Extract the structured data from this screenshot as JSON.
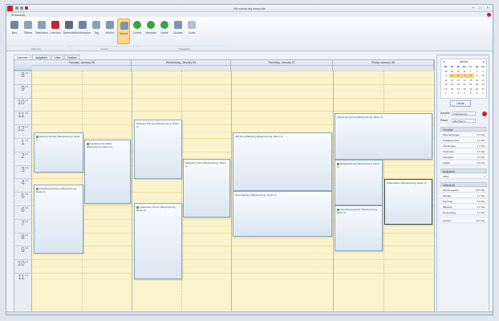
{
  "window": {
    "title": "Mit eindeutig lesscode"
  },
  "ribbon": {
    "tab": "Erfassen",
    "buttons": [
      {
        "label": "Neu",
        "color": "#6f86a0"
      },
      {
        "label": "Öffnen",
        "color": "#8aa0b6"
      },
      {
        "label": "Speichern",
        "color": "#8aa0b6"
      },
      {
        "label": "Löschen",
        "color": "#c0262d"
      },
      {
        "label": "Übersicht",
        "color": "#5a6a7a"
      },
      {
        "label": "Wochenplan",
        "color": "#6f86a0"
      },
      {
        "label": "Tag",
        "color": "#8aa0b6"
      },
      {
        "label": "Woche",
        "color": "#7f95ab"
      },
      {
        "label": "Monat",
        "color": "#7f95ab"
      },
      {
        "label": "Zurück",
        "color": "#3aa342"
      },
      {
        "label": "Vorwärts",
        "color": "#3aa342"
      },
      {
        "label": "Heute",
        "color": "#3aa342"
      },
      {
        "label": "Suchen",
        "color": "#7f95ab"
      },
      {
        "label": "Zoom",
        "color": "#b2c1d0"
      }
    ],
    "groups": [
      "Aktionen",
      "Ansicht",
      "Navigation"
    ]
  },
  "view_tabs": [
    "Kalender",
    "Aufgaben",
    "Liste",
    "Notizen"
  ],
  "days": [
    "Tuesday, January 05",
    "Wednesday, January 06",
    "Thursday, January 07",
    "Friday, January 08"
  ],
  "hours": [
    {
      "h": "8",
      "m": "00"
    },
    {
      "h": "9",
      "m": "00"
    },
    {
      "h": "10",
      "m": "00"
    },
    {
      "h": "11",
      "m": "00"
    },
    {
      "h": "12",
      "m": "00"
    },
    {
      "h": "1",
      "m": "00"
    },
    {
      "h": "2",
      "m": "00"
    },
    {
      "h": "3",
      "m": "00"
    },
    {
      "h": "4",
      "m": "00"
    },
    {
      "h": "5",
      "m": "00"
    },
    {
      "h": "6",
      "m": "00"
    },
    {
      "h": "7",
      "m": "00"
    },
    {
      "h": "8",
      "m": "00"
    },
    {
      "h": "9",
      "m": "00"
    },
    {
      "h": "10",
      "m": "00"
    },
    {
      "h": "11",
      "m": "00"
    }
  ],
  "appointments": [
    {
      "text": "Meeting Vertrieb (Besprechung, Raum 1)"
    },
    {
      "text": "Kundentermin Müller (Besprechung, Raum 2)"
    },
    {
      "text": "Projektbesprechung (Besprechung, Raum 2)"
    },
    {
      "text": "Strategie Planung (Besprechung, Raum 3)"
    },
    {
      "text": "Workshop Team (Besprechung, Raum 1)"
    },
    {
      "text": "Lieferanten Termin (Besprechung, Raum 4)"
    },
    {
      "text": "Schulung Marketing (Besprechung, Raum 1)"
    },
    {
      "text": "Team Meeting (Besprechung, Raum 2)"
    },
    {
      "text": "Abteilungsmeeting (Besprechung, Raum 2)"
    },
    {
      "text": "Budgetplanung (Besprechung, Raum 3)"
    },
    {
      "text": "Präsentation (Besprechung, Raum 4)"
    },
    {
      "text": "Abschlussgespräch (Besprechung, Raum 1)"
    }
  ],
  "mini_calendar": {
    "month": "Januar",
    "weekdays": [
      "Mo",
      "Di",
      "Mi",
      "Do",
      "Fr",
      "Sa",
      "So"
    ],
    "cells": [
      "28",
      "29",
      "30",
      "31",
      "1",
      "2",
      "3",
      "4",
      "5",
      "6",
      "7",
      "8",
      "9",
      "10",
      "11",
      "12",
      "13",
      "14",
      "15",
      "16",
      "17",
      "18",
      "19",
      "20",
      "21",
      "22",
      "23",
      "24",
      "25",
      "26",
      "27",
      "28",
      "29",
      "30",
      "31",
      "1",
      "2",
      "3",
      "4",
      "5",
      "6",
      "7"
    ],
    "highlight_start": 8,
    "highlight_end": 11,
    "today_label": "Heute"
  },
  "sidebar": {
    "fields": [
      {
        "label": "Ansicht",
        "value": "Arbeitswoche"
      },
      {
        "label": "Raum",
        "value": "Alle Räume"
      }
    ],
    "sections": [
      {
        "title": "Termine",
        "rows": [
          {
            "name": "Besprechungen",
            "time": "3,5 Std."
          },
          {
            "name": "Kundentermine",
            "time": "2,0 Std."
          },
          {
            "name": "Schulungen",
            "time": "1,5 Std."
          },
          {
            "name": "Telefonate",
            "time": "0,5 Std."
          },
          {
            "name": "Sonstiges",
            "time": "1,0 Std."
          },
          {
            "name": "Urlaub",
            "time": "0,0 Std."
          }
        ]
      },
      {
        "title": "Aufgaben",
        "rows": [
          {
            "name": "Offen",
            "time": "4"
          }
        ]
      },
      {
        "title": "Übersicht",
        "rows": [
          {
            "name": "Woche gesamt",
            "time": "18,5 Std."
          },
          {
            "name": "Montag",
            "time": "4,0 Std."
          },
          {
            "name": "Dienstag",
            "time": "5,5 Std."
          },
          {
            "name": "Mittwoch",
            "time": "3,0 Std."
          },
          {
            "name": "Donnerstag",
            "time": "6,0 Std."
          }
        ]
      },
      {
        "title": "",
        "rows": [
          {
            "name": "Gesamt",
            "time": "18,5 Std."
          }
        ]
      }
    ]
  }
}
